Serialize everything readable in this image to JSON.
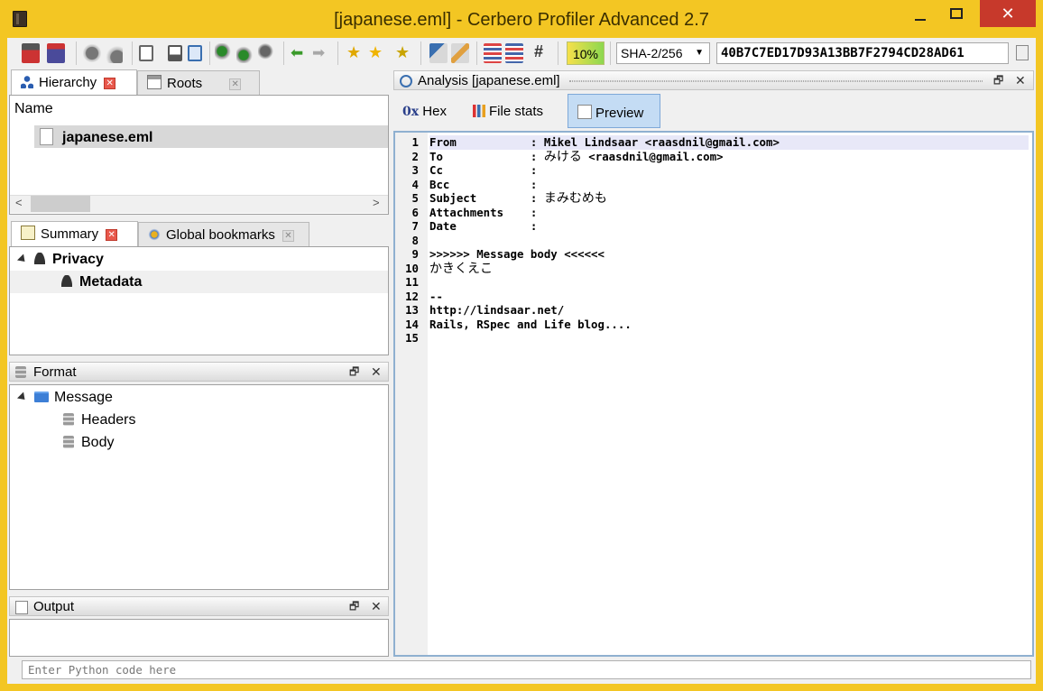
{
  "window": {
    "title": "[japanese.eml] - Cerbero Profiler Advanced 2.7"
  },
  "toolbar": {
    "progress": "10%",
    "hash_algorithm": "SHA-2/256",
    "hash_value": "40B7C7ED17D93A13BB7F2794CD28AD61",
    "hash_symbol": "#"
  },
  "hierarchy": {
    "tabs": [
      {
        "label": "Hierarchy"
      },
      {
        "label": "Roots"
      }
    ],
    "column": "Name",
    "items": [
      {
        "label": "japanese.eml"
      }
    ],
    "scroll_left": "<",
    "scroll_right": ">"
  },
  "summary": {
    "tabs": [
      {
        "label": "Summary"
      },
      {
        "label": "Global bookmarks"
      }
    ],
    "items": [
      {
        "label": "Privacy"
      },
      {
        "label": "Metadata"
      }
    ]
  },
  "format": {
    "title": "Format",
    "items": [
      {
        "label": "Message"
      },
      {
        "label": "Headers"
      },
      {
        "label": "Body"
      }
    ]
  },
  "output": {
    "title": "Output"
  },
  "analysis": {
    "title": "Analysis [japanese.eml]",
    "views": [
      {
        "label": "Hex",
        "prefix": "0x"
      },
      {
        "label": "File stats"
      },
      {
        "label": "Preview"
      }
    ],
    "lines": [
      {
        "num": "1",
        "text": "From           : Mikel Lindsaar <raasdnil@gmail.com>"
      },
      {
        "num": "2",
        "text": "To             : ",
        "jp": "みける",
        "tail": " <raasdnil@gmail.com>"
      },
      {
        "num": "3",
        "text": "Cc             :"
      },
      {
        "num": "4",
        "text": "Bcc            :"
      },
      {
        "num": "5",
        "text": "Subject        : ",
        "jp": "まみむめも",
        "tail": ""
      },
      {
        "num": "6",
        "text": "Attachments    :"
      },
      {
        "num": "7",
        "text": "Date           :"
      },
      {
        "num": "8",
        "text": ""
      },
      {
        "num": "9",
        "text": ">>>>>> Message body <<<<<<"
      },
      {
        "num": "10",
        "text": "",
        "jp": "かきくえこ",
        "tail": ""
      },
      {
        "num": "11",
        "text": ""
      },
      {
        "num": "12",
        "text": "--"
      },
      {
        "num": "13",
        "text": "http://lindsaar.net/"
      },
      {
        "num": "14",
        "text": "Rails, RSpec and Life blog...."
      },
      {
        "num": "15",
        "text": ""
      }
    ]
  },
  "python": {
    "placeholder": "Enter Python code here"
  },
  "colors": {
    "frame": "#f3c623",
    "close": "#c7392b",
    "selection": "#c4dcf4"
  }
}
